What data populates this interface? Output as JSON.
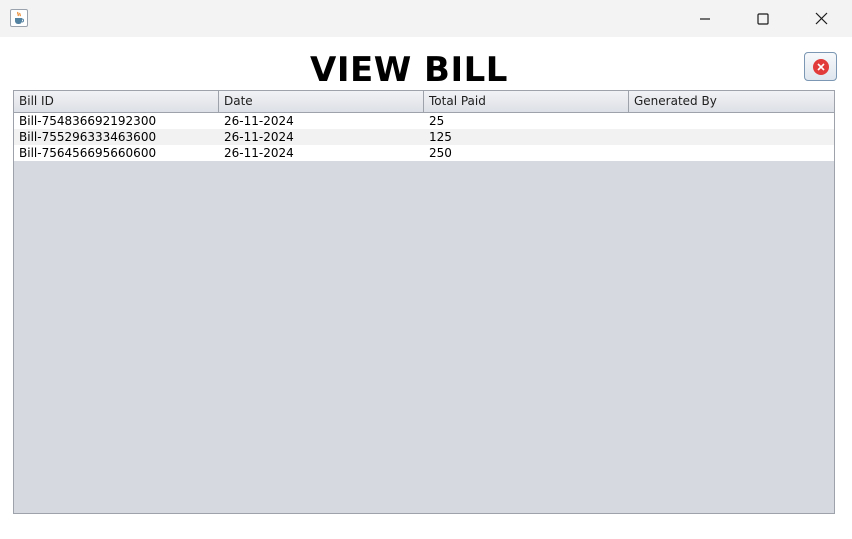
{
  "window": {
    "app_icon": "java-coffee-cup-icon",
    "controls": [
      "minimize-icon",
      "maximize-icon",
      "close-icon"
    ]
  },
  "page": {
    "title": "VIEW BILL",
    "exit_button_icon": "red-circle-x-icon"
  },
  "table": {
    "columns": [
      "Bill ID",
      "Date",
      "Total Paid",
      "Generated By"
    ],
    "rows": [
      [
        "Bill-754836692192300",
        "26-11-2024",
        "25",
        ""
      ],
      [
        "Bill-755296333463600",
        "26-11-2024",
        "125",
        ""
      ],
      [
        "Bill-756456695660600",
        "26-11-2024",
        "250",
        ""
      ]
    ]
  },
  "colors": {
    "exit_icon_red": "#e23b3b",
    "empty_table_area": "#d6d9e0"
  }
}
